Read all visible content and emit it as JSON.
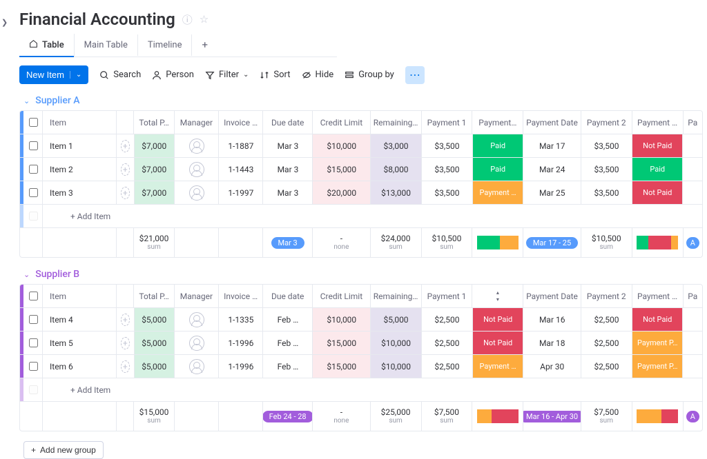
{
  "title": "Financial Accounting",
  "tabs": {
    "active": "Table",
    "items": [
      "Main Table",
      "Timeline"
    ]
  },
  "newItem": "New Item",
  "toolbar": {
    "search": "Search",
    "person": "Person",
    "filter": "Filter",
    "sort": "Sort",
    "hide": "Hide",
    "group": "Group by"
  },
  "columns": [
    "Item",
    "Total P…",
    "Manager",
    "Invoice …",
    "Due date",
    "Credit Limit",
    "Remaining…",
    "Payment 1",
    "Payment…",
    "Payment Date",
    "Payment 2",
    "Payment …",
    "Pa"
  ],
  "groups": [
    {
      "name": "Supplier A",
      "color": "blue",
      "rows": [
        {
          "item": "Item 1",
          "total": "$7,000",
          "inv": "1-1887",
          "due": "Mar 3",
          "credit": "$10,000",
          "rem": "$3,000",
          "p1": "$3,500",
          "ps": "Paid",
          "psCls": "s-paid",
          "pd": "Mar 17",
          "p2": "$3,500",
          "ps2": "Not Paid",
          "ps2Cls": "s-np"
        },
        {
          "item": "Item 2",
          "total": "$7,000",
          "inv": "1-1443",
          "due": "Mar 3",
          "credit": "$15,000",
          "rem": "$8,000",
          "p1": "$3,500",
          "ps": "Paid",
          "psCls": "s-paid",
          "pd": "Mar 24",
          "p2": "$3,500",
          "ps2": "Paid",
          "ps2Cls": "s-paid"
        },
        {
          "item": "Item 3",
          "total": "$7,000",
          "inv": "1-1997",
          "due": "Mar 3",
          "credit": "$20,000",
          "rem": "$13,000",
          "p1": "$3,500",
          "ps": "Payment …",
          "psCls": "s-pp",
          "pd": "Mar 25",
          "p2": "$3,500",
          "ps2": "Not Paid",
          "ps2Cls": "s-np"
        }
      ],
      "addItem": "+ Add Item",
      "sum": {
        "total": "$21,000",
        "due": "Mar 3",
        "credit": "-",
        "creditNote": "none",
        "rem": "$24,000",
        "p1": "$10,500",
        "pd": "Mar 17 - 25",
        "p2": "$10,500",
        "bar1": [
          [
            "#00c875",
            55
          ],
          [
            "#fdab3d",
            45
          ]
        ],
        "bar2": [
          [
            "#00c875",
            28
          ],
          [
            "#e2445c",
            55
          ],
          [
            "#fdab3d",
            17
          ]
        ],
        "pdCls": "",
        "dot": "A",
        "dotBg": "#579bfc"
      }
    },
    {
      "name": "Supplier B",
      "color": "purple",
      "rows": [
        {
          "item": "Item 4",
          "total": "$5,000",
          "inv": "1-1335",
          "due": "Feb …",
          "credit": "$10,000",
          "rem": "$5,000",
          "p1": "$2,500",
          "ps": "Not Paid",
          "psCls": "s-np",
          "pd": "Mar 16",
          "p2": "$2,500",
          "ps2": "Not Paid",
          "ps2Cls": "s-np"
        },
        {
          "item": "Item 5",
          "total": "$5,000",
          "inv": "1-1996",
          "due": "Feb …",
          "credit": "$15,000",
          "rem": "$10,000",
          "p1": "$2,500",
          "ps": "Not Paid",
          "psCls": "s-np",
          "pd": "Mar 18",
          "p2": "$2,500",
          "ps2": "Payment P…",
          "ps2Cls": "s-pp"
        },
        {
          "item": "Item 6",
          "total": "$5,000",
          "inv": "1-1996",
          "due": "Feb …",
          "credit": "$15,000",
          "rem": "$10,000",
          "p1": "$2,500",
          "ps": "Payment …",
          "psCls": "s-pp",
          "pd": "Apr 30",
          "p2": "$2,500",
          "ps2": "Payment P…",
          "ps2Cls": "s-pp"
        }
      ],
      "addItem": "+ Add Item",
      "sum": {
        "total": "$15,000",
        "due": "Feb 24 - 28",
        "credit": "-",
        "creditNote": "none",
        "rem": "$25,000",
        "p1": "$7,500",
        "pd": "Mar 16 - Apr 30",
        "p2": "$7,500",
        "bar1": [
          [
            "#fdab3d",
            35
          ],
          [
            "#e2445c",
            65
          ]
        ],
        "bar2": [
          [
            "#fdab3d",
            60
          ],
          [
            "#e2445c",
            40
          ]
        ],
        "pdCls": "pur",
        "dot": "A",
        "dotBg": "#a25ddc"
      }
    }
  ],
  "sumLabel": "sum",
  "addGroup": "Add new group"
}
